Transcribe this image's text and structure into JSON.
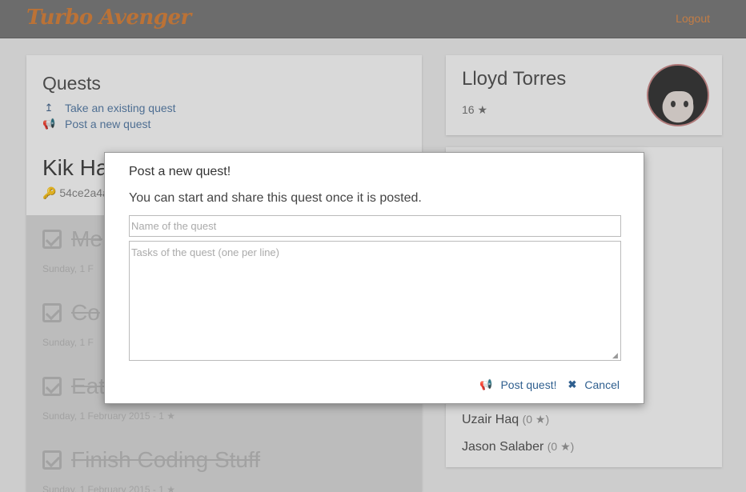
{
  "app": {
    "brand": "Turbo Avenger",
    "logout": "Logout"
  },
  "quests": {
    "title": "Quests",
    "links": [
      {
        "label": "Take an existing quest",
        "icon": "upload-arrow-icon"
      },
      {
        "label": "Post a new quest",
        "icon": "bullhorn-icon"
      }
    ],
    "current": {
      "name": "Kik Ha",
      "id": "54ce2a4a"
    },
    "tasks": [
      {
        "name": "Me",
        "meta": "Sunday, 1 F"
      },
      {
        "name": "Co",
        "meta": "Sunday, 1 F"
      },
      {
        "name": "Eat",
        "meta": "Sunday, 1 February 2015 - 1 ★"
      },
      {
        "name": "Finish Coding Stuff",
        "meta": "Sunday, 1 February 2015 - 1 ★"
      }
    ]
  },
  "profile": {
    "name": "Lloyd Torres",
    "stars": "16 ★"
  },
  "players": [
    {
      "name": "Uzair Haq",
      "points": "(0 ★)"
    },
    {
      "name": "Jason Salaber",
      "points": "(0 ★)"
    }
  ],
  "modal": {
    "title": "Post a new quest!",
    "description": "You can start and share this quest once it is posted.",
    "name_placeholder": "Name of the quest",
    "tasks_placeholder": "Tasks of the quest (one per line)",
    "post_label": "Post quest!",
    "cancel_label": "Cancel"
  },
  "colors": {
    "brand": "#d7843f",
    "link": "#5a7fa8",
    "action": "#2f5f8f"
  }
}
